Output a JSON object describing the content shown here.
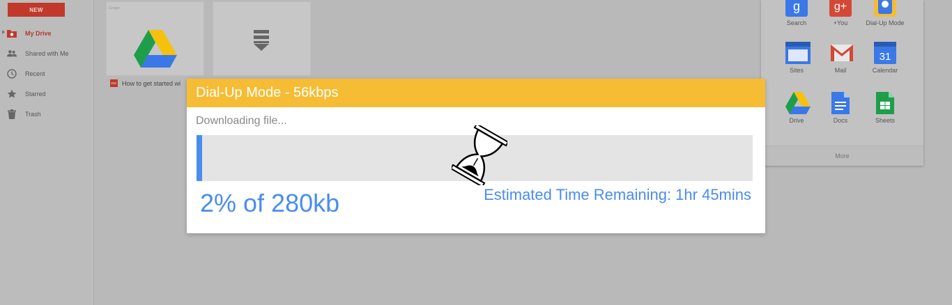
{
  "sidebar": {
    "new_label": "NEW",
    "items": [
      {
        "label": "My Drive",
        "icon": "drive-folder-icon",
        "active": true
      },
      {
        "label": "Shared with Me",
        "icon": "people-icon"
      },
      {
        "label": "Recent",
        "icon": "clock-icon"
      },
      {
        "label": "Starred",
        "icon": "star-icon"
      },
      {
        "label": "Trash",
        "icon": "trash-icon"
      }
    ]
  },
  "files": {
    "tile1_label": "Google",
    "caption": "How to get started wi",
    "pdf_badge": "PDF"
  },
  "apps": {
    "items": [
      {
        "label": "Search",
        "icon": "google-search-icon"
      },
      {
        "label": "+You",
        "icon": "google-plus-icon"
      },
      {
        "label": "Dial-Up Mode",
        "icon": "dialup-mode-icon"
      },
      {
        "label": "Sites",
        "icon": "sites-icon"
      },
      {
        "label": "Mail",
        "icon": "gmail-icon"
      },
      {
        "label": "Calendar",
        "icon": "calendar-icon",
        "badge": "31"
      },
      {
        "label": "Drive",
        "icon": "drive-icon"
      },
      {
        "label": "Docs",
        "icon": "docs-icon"
      },
      {
        "label": "Sheets",
        "icon": "sheets-icon"
      }
    ],
    "more_label": "More"
  },
  "dialog": {
    "title": "Dial-Up Mode - 56kbps",
    "status": "Downloading file...",
    "progress_percent": 1,
    "percent_text": "2% of 280kb",
    "eta_text": "Estimated Time Remaining: 1hr 45mins",
    "progress_color": "#4a8cf0",
    "header_color": "#f5bc34"
  },
  "cursor": {
    "icon": "hourglass-busy-icon"
  }
}
